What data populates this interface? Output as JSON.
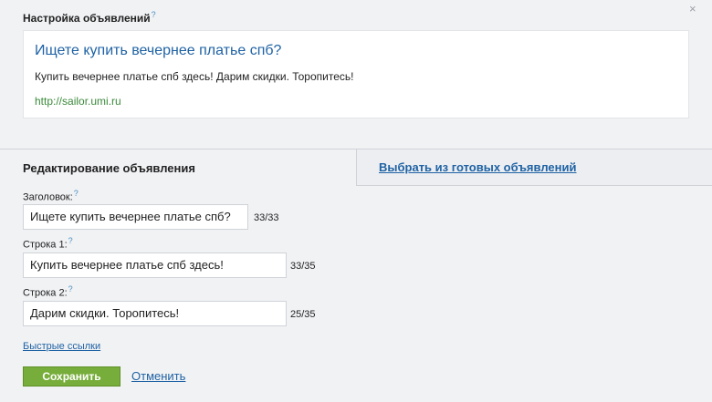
{
  "panel": {
    "title": "Настройка объявлений",
    "help": "?",
    "close_glyph": "×"
  },
  "preview": {
    "title": "Ищете купить вечернее платье спб?",
    "text": "Купить вечернее платье спб здесь! Дарим скидки. Торопитесь!",
    "url": "http://sailor.umi.ru"
  },
  "tabs": {
    "active": "Редактирование объявления",
    "other": "Выбрать из готовых объявлений"
  },
  "fields": [
    {
      "label": "Заголовок:",
      "help": "?",
      "value": "Ищете купить вечернее платье спб?",
      "counter": "33/33"
    },
    {
      "label": "Строка 1:",
      "help": "?",
      "value": "Купить вечернее платье спб здесь!",
      "counter": "33/35"
    },
    {
      "label": "Строка 2:",
      "help": "?",
      "value": "Дарим скидки. Торопитесь!",
      "counter": "25/35"
    }
  ],
  "quick_links": "Быстрые ссылки",
  "actions": {
    "save": "Сохранить",
    "cancel": "Отменить"
  },
  "colors": {
    "link": "#1f62a4",
    "url_green": "#3b8a3b",
    "save_button": "#77ad3a",
    "background": "#f1f2f4"
  }
}
